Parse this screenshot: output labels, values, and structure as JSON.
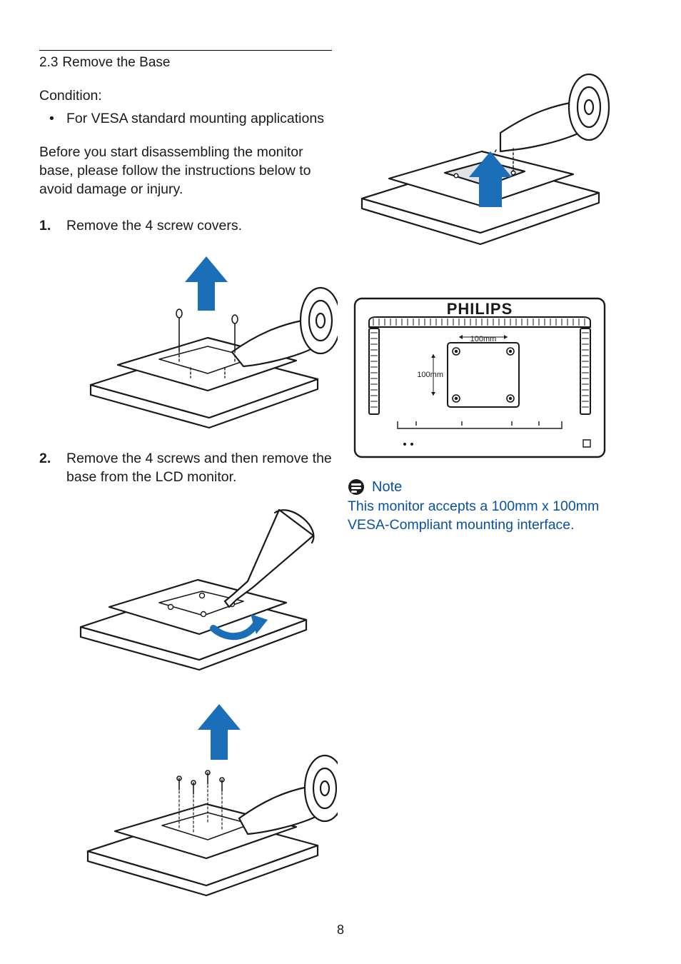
{
  "page_number": "8",
  "left": {
    "section_number": "2.3",
    "section_title": "Remove the Base",
    "condition_label": "Condition:",
    "bullets": [
      "For VESA standard mounting applications"
    ],
    "intro": "Before you start disassembling the monitor base, please follow the instructions below to avoid damage or injury.",
    "steps": [
      "Remove the 4 screw covers.",
      "Remove the 4 screws and then remove the base from the LCD monitor."
    ]
  },
  "right": {
    "brand": "PHILIPS",
    "vesa_dims": {
      "w": "100mm",
      "h": "100mm"
    },
    "note_label": "Note",
    "note_text": "This monitor accepts a 100mm x 100mm VESA-Compliant mounting interface."
  }
}
